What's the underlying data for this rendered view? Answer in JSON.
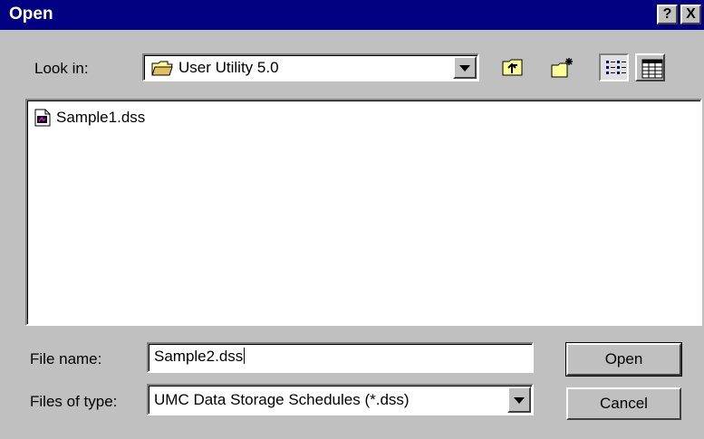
{
  "window": {
    "title": "Open",
    "help_glyph": "?",
    "close_glyph": "X"
  },
  "look_in": {
    "label": "Look in:",
    "folder": "User Utility 5.0",
    "icon": "folder-icon"
  },
  "toolbar": {
    "up_icon": "up-one-level-icon",
    "new_folder_icon": "new-folder-icon",
    "list_icon": "list-view-icon",
    "details_icon": "details-view-icon"
  },
  "files": [
    {
      "name": "Sample1.dss",
      "icon": "dss-file-icon"
    }
  ],
  "file_name": {
    "label": "File name:",
    "value": "Sample2.dss"
  },
  "file_type": {
    "label": "Files of type:",
    "value": "UMC Data Storage Schedules (*.dss)"
  },
  "buttons": {
    "open": "Open",
    "cancel": "Cancel"
  },
  "colors": {
    "titlebar": "#000080",
    "face": "#c0c0c0"
  }
}
